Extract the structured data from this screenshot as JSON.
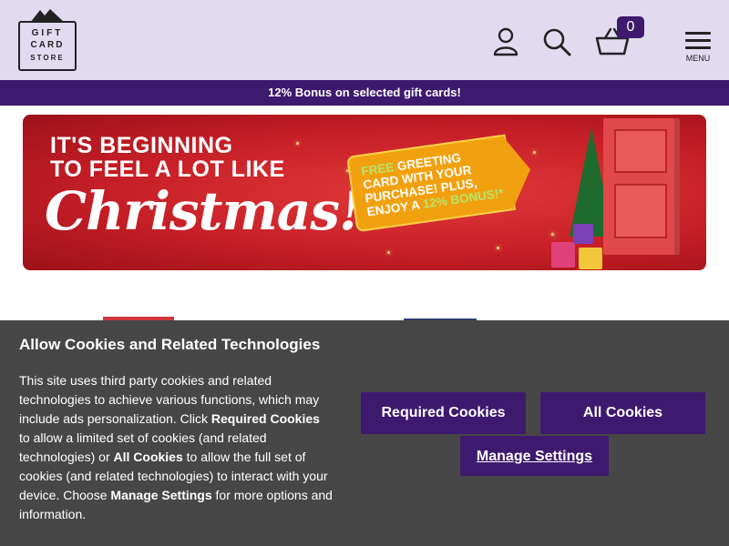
{
  "header": {
    "logo": {
      "line1": "GIFT",
      "line2": "CARD",
      "line3": "STORE"
    },
    "cart_count": "0",
    "menu_label": "MENU"
  },
  "promo_bar": {
    "text": "12% Bonus on selected gift cards!"
  },
  "banner": {
    "line1": "IT'S BEGINNING",
    "line2": "TO FEEL A LOT LIKE",
    "script": "Christmas!",
    "tag": {
      "free": "FREE",
      "line1_rest": " GREETING",
      "line2": "CARD WITH YOUR",
      "line3": "PURCHASE! PLUS,",
      "line4_a": "ENJOY A ",
      "line4_b": "12% BONUS!*"
    }
  },
  "cookie_banner": {
    "title": "Allow Cookies and Related Technologies",
    "body_1": "This site uses third party cookies and related technologies to achieve various functions, which may include ads personalization. Click ",
    "body_b1": "Required Cookies",
    "body_2": " to allow a limited set of cookies (and related technologies) or ",
    "body_b2": "All Cookies",
    "body_3": " to allow the full set of cookies (and related technologies) to interact with your device. Choose ",
    "body_b3": "Manage Settings",
    "body_4": " for more options and information.",
    "required_button": "Required Cookies",
    "all_button": "All Cookies",
    "manage_button": "Manage Settings"
  },
  "colors": {
    "header_bg": "#e2dbef",
    "brand_purple": "#3d1a6e",
    "banner_red": "#c61f27",
    "tag_orange": "#f1a10f",
    "cookie_bg": "#474747"
  },
  "icons": [
    "logo-mountain-icon",
    "account-icon",
    "search-icon",
    "basket-icon",
    "hamburger-menu-icon"
  ]
}
